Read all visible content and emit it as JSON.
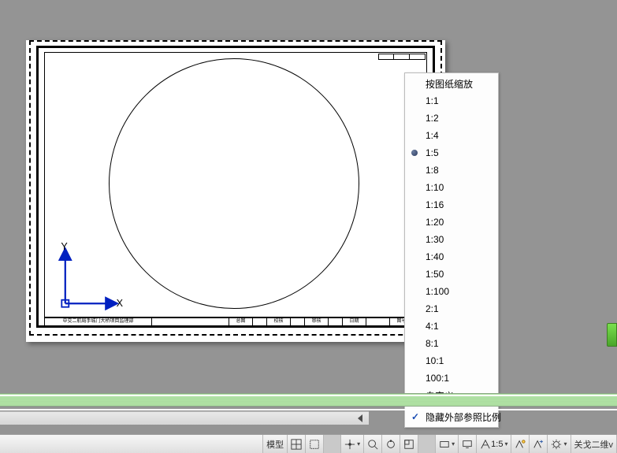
{
  "axes": {
    "x_label": "X",
    "y_label": "Y"
  },
  "title_block": {
    "left_text": "中交二航局手城门大桥项目监理部",
    "cells": [
      "总图",
      "校核",
      "审核",
      "日期",
      "图号"
    ]
  },
  "scale_menu": {
    "header": "按图纸缩放",
    "items": [
      "1:1",
      "1:2",
      "1:4",
      "1:5",
      "1:8",
      "1:10",
      "1:16",
      "1:20",
      "1:30",
      "1:40",
      "1:50",
      "1:100",
      "2:1",
      "4:1",
      "8:1",
      "10:1",
      "100:1"
    ],
    "selected": "1:5",
    "custom": "自定义…",
    "hide_xref": "隐藏外部参照比例"
  },
  "status_bar": {
    "model_tab": "模型",
    "anno_scale": "1:5",
    "iso_label": "关戈二维v"
  },
  "icon_names": {
    "grid": "grid-icon",
    "snap": "snap-icon",
    "ortho": "ortho-icon",
    "pan": "pan-icon",
    "zoom": "zoom-icon",
    "rotate": "rotate-icon",
    "layout": "layout-icon",
    "workspace": "workspace-icon",
    "monitor": "monitor-icon",
    "anno": "anno-icon",
    "scale": "scale-icon",
    "gear": "gear-icon"
  }
}
